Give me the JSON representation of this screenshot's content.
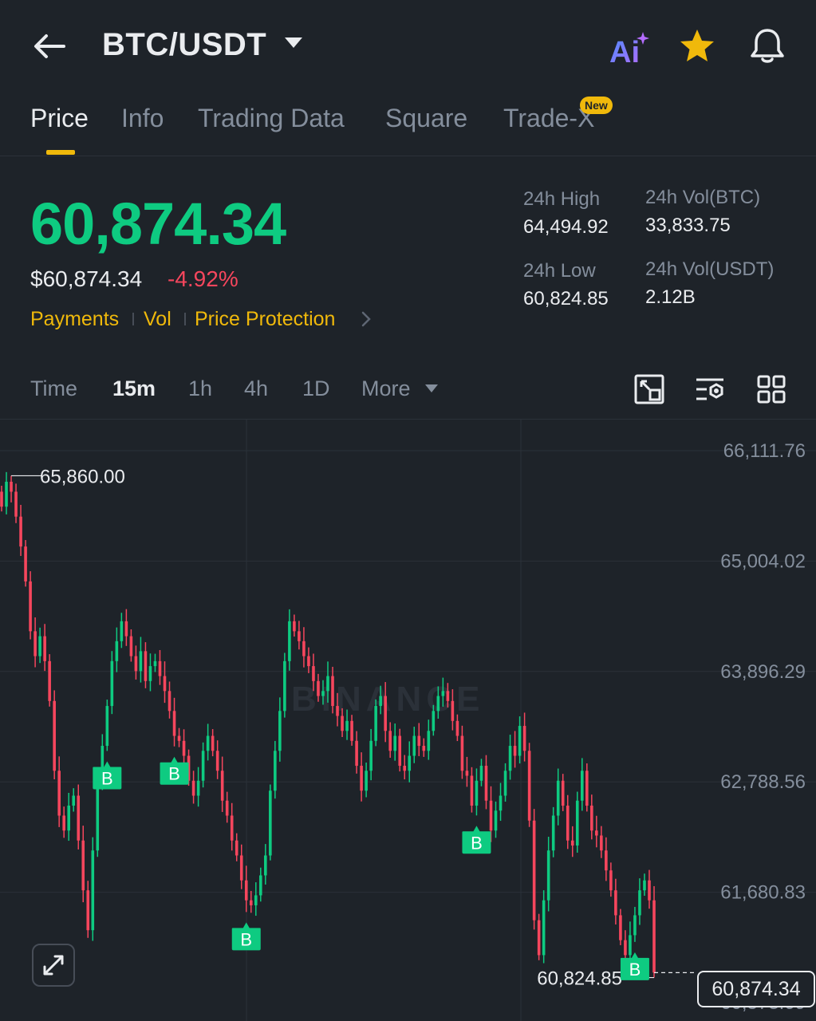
{
  "header": {
    "pair": "BTC/USDT",
    "ai_label": "Ai",
    "icons": [
      "back-arrow-icon",
      "caret-down-icon",
      "ai-icon",
      "star-icon",
      "bell-icon"
    ],
    "star_color": "#f0b90b"
  },
  "tabs": [
    {
      "label": "Price",
      "active": true
    },
    {
      "label": "Info",
      "active": false
    },
    {
      "label": "Trading Data",
      "active": false
    },
    {
      "label": "Square",
      "active": false
    },
    {
      "label": "Trade-X",
      "active": false,
      "badge": "New"
    }
  ],
  "price": {
    "last": "60,874.34",
    "usd": "$60,874.34",
    "change": "-4.92%",
    "up_color": "#0ecb81",
    "down_color": "#f6465d"
  },
  "links": [
    "Payments",
    "Vol",
    "Price Protection"
  ],
  "stats": {
    "high_label": "24h High",
    "high_value": "64,494.92",
    "vol_btc_label": "24h Vol(BTC)",
    "vol_btc_value": "33,833.75",
    "low_label": "24h Low",
    "low_value": "60,824.85",
    "vol_usdt_label": "24h Vol(USDT)",
    "vol_usdt_value": "2.12B"
  },
  "timeframes": [
    {
      "label": "Time",
      "active": false
    },
    {
      "label": "15m",
      "active": true
    },
    {
      "label": "1h",
      "active": false
    },
    {
      "label": "4h",
      "active": false
    },
    {
      "label": "1D",
      "active": false
    },
    {
      "label": "More",
      "active": false
    }
  ],
  "tools": [
    "chart-settings-icon",
    "indicator-settings-icon",
    "layout-grid-icon"
  ],
  "chart_data": {
    "type": "candlestick",
    "y_ticks": [
      "66,111.76",
      "65,004.02",
      "63,896.29",
      "62,788.56",
      "61,680.83",
      "60,573.09"
    ],
    "ylim": [
      60573.09,
      66111.76
    ],
    "high_marker": "65,860.00",
    "low_marker": "60,824.85",
    "current_price": "60,874.34",
    "buy_marker_label": "B",
    "watermark": "BINANCE",
    "grid": true,
    "close_series": [
      65550,
      65800,
      65700,
      65450,
      65150,
      64800,
      64300,
      64050,
      64250,
      64000,
      63600,
      62900,
      62450,
      62300,
      62550,
      62650,
      62200,
      61700,
      61300,
      62100,
      62800,
      63150,
      63550,
      64000,
      64200,
      64400,
      64250,
      64050,
      63900,
      64100,
      63800,
      63950,
      64000,
      63850,
      63700,
      63500,
      63250,
      63200,
      63050,
      62800,
      62650,
      62800,
      63100,
      63250,
      63100,
      62900,
      62600,
      62450,
      62200,
      62050,
      61800,
      61600,
      61550,
      61650,
      61850,
      62050,
      62700,
      63100,
      63500,
      64000,
      64400,
      64300,
      64200,
      64050,
      63950,
      63800,
      63650,
      63700,
      63850,
      63550,
      63450,
      63300,
      63400,
      63200,
      62950,
      62700,
      62900,
      63200,
      63550,
      63650,
      63300,
      63100,
      63250,
      62950,
      62900,
      63050,
      63250,
      63150,
      63100,
      63300,
      63500,
      63650,
      63700,
      63600,
      63400,
      63250,
      62900,
      62850,
      62550,
      62800,
      62950,
      62600,
      62300,
      62500,
      62650,
      62900,
      63150,
      63050,
      63350,
      63100,
      62400,
      61400,
      61050,
      61600,
      62100,
      62450,
      62800,
      62550,
      62200,
      62150,
      62600,
      62900,
      62550,
      62300,
      62250,
      62100,
      61900,
      61700,
      61450,
      61200,
      61050,
      61250,
      61450,
      61700,
      61800,
      61600,
      60874
    ]
  }
}
